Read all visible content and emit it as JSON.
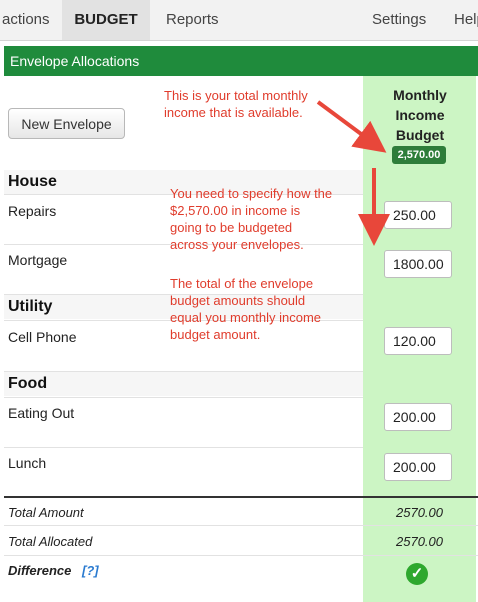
{
  "nav": {
    "actions": "actions",
    "budget": "BUDGET",
    "reports": "Reports",
    "settings": "Settings",
    "help": "Help"
  },
  "header": {
    "title": "Envelope Allocations"
  },
  "new_envelope_label": "New Envelope",
  "income": {
    "heading_line1": "Monthly",
    "heading_line2": "Income",
    "heading_line3": "Budget",
    "badge": "2,570.00"
  },
  "categories": [
    {
      "name": "House",
      "items": [
        {
          "name": "Repairs",
          "amount": "250.00"
        },
        {
          "name": "Mortgage",
          "amount": "1800.00"
        }
      ]
    },
    {
      "name": "Utility",
      "items": [
        {
          "name": "Cell Phone",
          "amount": "120.00"
        }
      ]
    },
    {
      "name": "Food",
      "items": [
        {
          "name": "Eating Out",
          "amount": "200.00"
        },
        {
          "name": "Lunch",
          "amount": "200.00"
        }
      ]
    }
  ],
  "totals": {
    "total_amount_label": "Total Amount",
    "total_amount": "2570.00",
    "total_allocated_label": "Total Allocated",
    "total_allocated": "2570.00",
    "difference_label": "Difference",
    "difference_help": "[?]"
  },
  "annotations": {
    "note1": [
      "This is your total monthly",
      "income that is available."
    ],
    "note2": [
      "You need to specify how the",
      "$2,570.00 in income is",
      "going to be budgeted",
      "across your envelopes."
    ],
    "note3": [
      "The total of the envelope",
      "budget amounts should",
      "equal you monthly income",
      "budget amount."
    ]
  },
  "colors": {
    "header_green": "#1f8b3c",
    "income_column": "#ccf5c4",
    "annotation_red": "#e03c2c",
    "badge_green": "#2e7d3a"
  }
}
